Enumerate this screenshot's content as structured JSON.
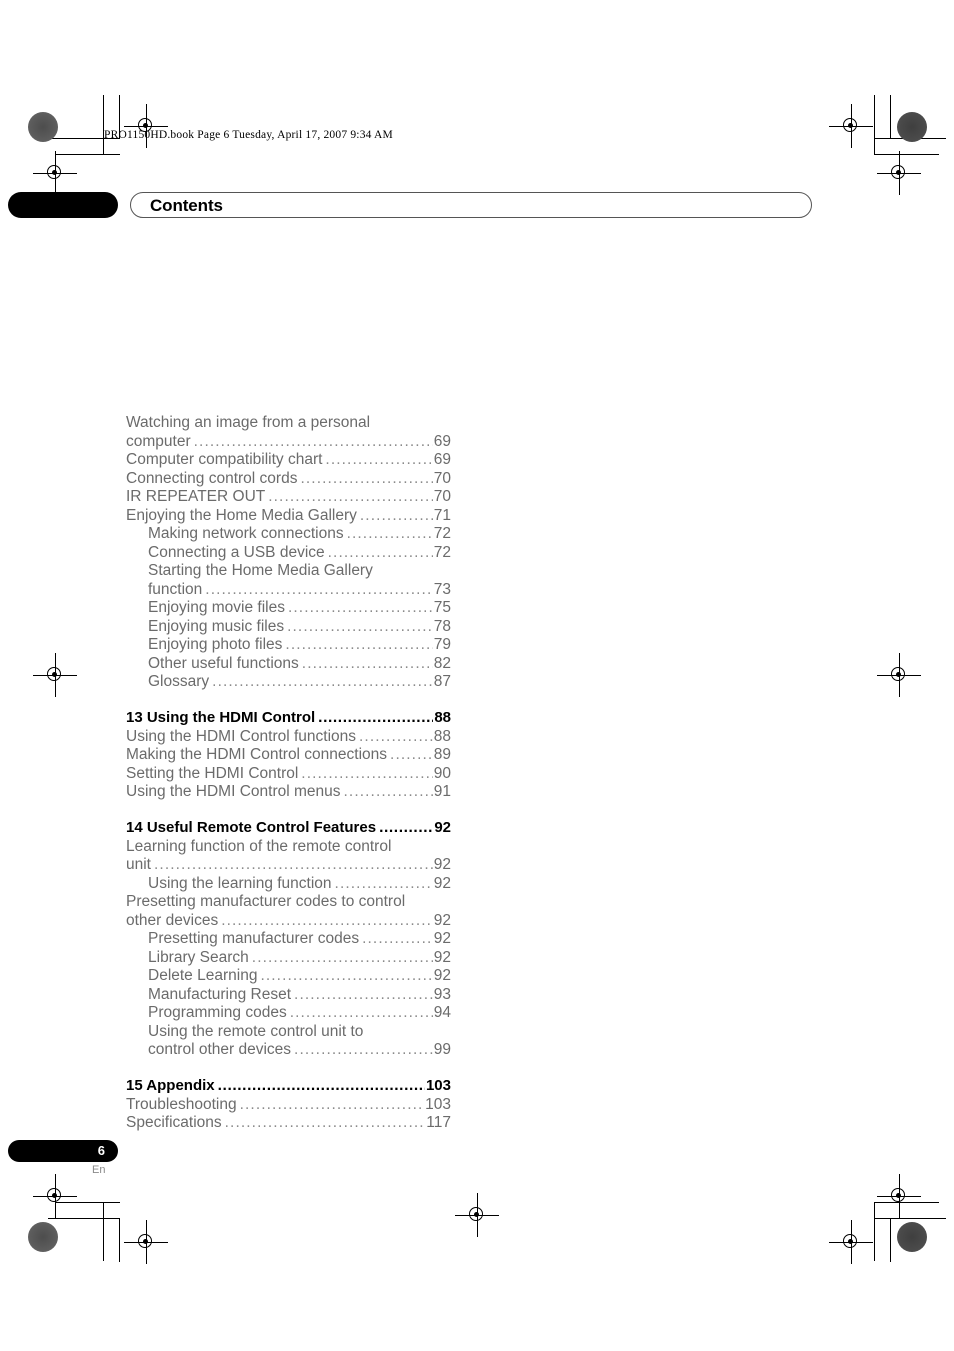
{
  "print_marks": {
    "header_stamp": "PRO1150HD.book  Page 6  Tuesday, April 17, 2007  9:34 AM"
  },
  "header": {
    "title": "Contents"
  },
  "footer": {
    "page_number": "6",
    "language_code": "En"
  },
  "toc": {
    "entries": [
      {
        "level": 0,
        "kind": "item",
        "label": "Watching an image from a personal",
        "page": "",
        "wrap_start": true
      },
      {
        "level": 0,
        "kind": "item",
        "label": "computer",
        "page": "69"
      },
      {
        "level": 0,
        "kind": "item",
        "label": "Computer compatibility chart",
        "page": "69"
      },
      {
        "level": 0,
        "kind": "item",
        "label": "Connecting control cords",
        "page": "70"
      },
      {
        "level": 0,
        "kind": "item",
        "label": "IR REPEATER OUT",
        "page": "70"
      },
      {
        "level": 0,
        "kind": "item",
        "label": "Enjoying the Home Media Gallery",
        "page": "71"
      },
      {
        "level": 1,
        "kind": "item",
        "label": "Making network connections",
        "page": "72"
      },
      {
        "level": 1,
        "kind": "item",
        "label": "Connecting a USB device",
        "page": "72"
      },
      {
        "level": 1,
        "kind": "item",
        "label": "Starting the Home Media Gallery",
        "page": "",
        "wrap_start": true
      },
      {
        "level": 1,
        "kind": "item",
        "label": "function",
        "page": "73"
      },
      {
        "level": 1,
        "kind": "item",
        "label": "Enjoying movie files",
        "page": "75"
      },
      {
        "level": 1,
        "kind": "item",
        "label": "Enjoying music files",
        "page": "78"
      },
      {
        "level": 1,
        "kind": "item",
        "label": "Enjoying photo files",
        "page": "79"
      },
      {
        "level": 1,
        "kind": "item",
        "label": "Other useful functions",
        "page": "82"
      },
      {
        "level": 1,
        "kind": "item",
        "label": "Glossary",
        "page": "87"
      },
      {
        "level": 0,
        "kind": "chapter",
        "label": "13 Using the HDMI Control",
        "page": "88",
        "gap": true
      },
      {
        "level": 0,
        "kind": "item",
        "label": "Using the HDMI Control functions",
        "page": "88"
      },
      {
        "level": 0,
        "kind": "item",
        "label": "Making the HDMI Control connections",
        "page": "89"
      },
      {
        "level": 0,
        "kind": "item",
        "label": "Setting the HDMI Control",
        "page": "90"
      },
      {
        "level": 0,
        "kind": "item",
        "label": "Using the HDMI Control menus",
        "page": "91"
      },
      {
        "level": 0,
        "kind": "chapter",
        "label": "14 Useful Remote Control Features",
        "page": "92",
        "gap": true
      },
      {
        "level": 0,
        "kind": "item",
        "label": "Learning function of the remote control",
        "page": "",
        "wrap_start": true
      },
      {
        "level": 0,
        "kind": "item",
        "label": "unit",
        "page": "92"
      },
      {
        "level": 1,
        "kind": "item",
        "label": "Using the learning function",
        "page": "92"
      },
      {
        "level": 0,
        "kind": "item",
        "label": "Presetting manufacturer codes to control",
        "page": "",
        "wrap_start": true
      },
      {
        "level": 0,
        "kind": "item",
        "label": "other devices",
        "page": "92"
      },
      {
        "level": 1,
        "kind": "item",
        "label": "Presetting manufacturer codes",
        "page": "92"
      },
      {
        "level": 1,
        "kind": "item",
        "label": "Library Search",
        "page": "92"
      },
      {
        "level": 1,
        "kind": "item",
        "label": "Delete Learning",
        "page": "92"
      },
      {
        "level": 1,
        "kind": "item",
        "label": "Manufacturing Reset",
        "page": "93"
      },
      {
        "level": 1,
        "kind": "item",
        "label": "Programming  codes",
        "page": "94"
      },
      {
        "level": 1,
        "kind": "item",
        "label": "Using the remote control unit to",
        "page": "",
        "wrap_start": true
      },
      {
        "level": 1,
        "kind": "item",
        "label": "control other devices",
        "page": "99"
      },
      {
        "level": 0,
        "kind": "chapter",
        "label": "15 Appendix",
        "page": "103",
        "gap": true
      },
      {
        "level": 0,
        "kind": "item",
        "label": "Troubleshooting",
        "page": "103"
      },
      {
        "level": 0,
        "kind": "item",
        "label": "Specifications",
        "page": "117"
      }
    ]
  }
}
